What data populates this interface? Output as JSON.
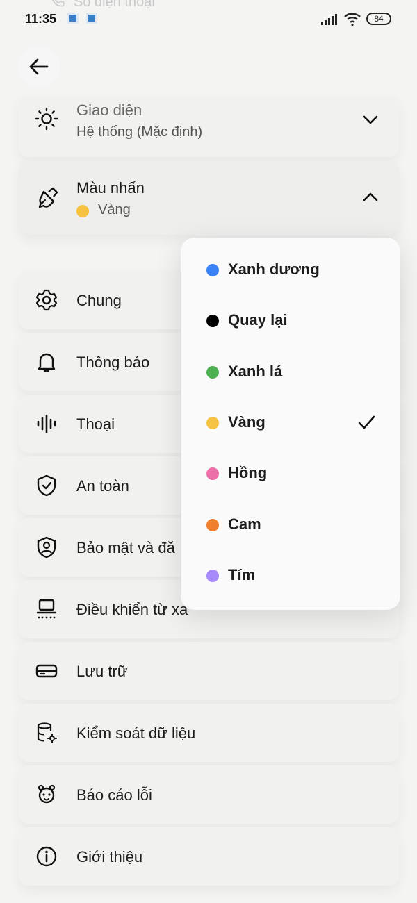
{
  "status_bar": {
    "time": "11:35",
    "ghost_text": "Số điện thoại",
    "battery": "84",
    "icons": [
      "notification-app-icon",
      "notification-app-icon",
      "signal-icon",
      "wifi-icon",
      "battery-icon"
    ]
  },
  "header": {
    "back_icon": "arrow-left-icon"
  },
  "settings": {
    "appearance": {
      "icon": "sun-icon",
      "label": "Giao diện",
      "value": "Hệ thống (Mặc định)",
      "chevron": "chevron-down-icon"
    },
    "accent": {
      "icon": "paint-brush-icon",
      "label": "Màu nhấn",
      "value": "Vàng",
      "value_color": "#f5c242",
      "chevron": "chevron-up-icon"
    },
    "items": [
      {
        "icon": "gear-icon",
        "label": "Chung"
      },
      {
        "icon": "bell-icon",
        "label": "Thông báo"
      },
      {
        "icon": "voice-wave-icon",
        "label": "Thoại"
      },
      {
        "icon": "shield-check-icon",
        "label": "An toàn"
      },
      {
        "icon": "user-shield-icon",
        "label": "Bảo mật và đă"
      },
      {
        "icon": "laptop-remote-icon",
        "label": "Điều khiển từ xa"
      },
      {
        "icon": "drive-icon",
        "label": "Lưu trữ"
      },
      {
        "icon": "database-gear-icon",
        "label": "Kiểm soát dữ liệu"
      },
      {
        "icon": "bug-icon",
        "label": "Báo cáo lỗi"
      },
      {
        "icon": "info-icon",
        "label": "Giới thiệu"
      }
    ]
  },
  "accent_menu": {
    "selected": "Vàng",
    "options": [
      {
        "label": "Xanh dương",
        "color": "#3b82f6"
      },
      {
        "label": "Quay lại",
        "color": "#000000"
      },
      {
        "label": "Xanh lá",
        "color": "#4caf50"
      },
      {
        "label": "Vàng",
        "color": "#f5c242",
        "checked": true
      },
      {
        "label": "Hồng",
        "color": "#ec6fa7"
      },
      {
        "label": "Cam",
        "color": "#ee7f2e"
      },
      {
        "label": "Tím",
        "color": "#a78bfa"
      }
    ]
  }
}
